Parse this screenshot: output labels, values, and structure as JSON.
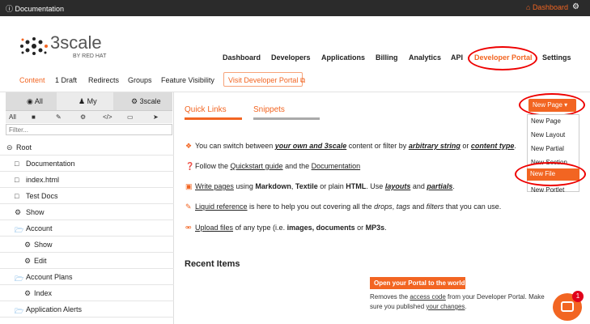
{
  "topbar": {
    "title": "Documentation",
    "dashboard": "Dashboard",
    "info_icon": "info-icon",
    "gear_icon": "gear-icon",
    "home_icon": "home-icon"
  },
  "logo": {
    "name": "3scale",
    "sub": "BY RED HAT"
  },
  "nav": {
    "items": [
      "Dashboard",
      "Developers",
      "Applications",
      "Billing",
      "Analytics",
      "API",
      "Developer Portal",
      "Settings"
    ]
  },
  "subnav": {
    "items": [
      "Content",
      "1 Draft",
      "Redirects",
      "Groups",
      "Feature Visibility"
    ],
    "visit": "Visit Developer Portal"
  },
  "sidebar": {
    "tabs": [
      "All",
      "My",
      "3scale"
    ],
    "types": [
      "All",
      "■",
      "✎",
      "⚙",
      "</>",
      "▭",
      "➤"
    ],
    "filter_placeholder": "Filter...",
    "root": "Root",
    "rows": [
      {
        "label": "Documentation",
        "icon": "file-icon"
      },
      {
        "label": "index.html",
        "icon": "file-icon"
      },
      {
        "label": "Test Docs",
        "icon": "file-icon"
      },
      {
        "label": "Show",
        "icon": "gear-icon"
      },
      {
        "label": "Account",
        "icon": "folder-icon"
      },
      {
        "label": "Show",
        "icon": "gear-icon"
      },
      {
        "label": "Edit",
        "icon": "gear-icon"
      },
      {
        "label": "Account Plans",
        "icon": "folder-icon"
      },
      {
        "label": "Index",
        "icon": "gear-icon"
      },
      {
        "label": "Application Alerts",
        "icon": "folder-icon"
      }
    ]
  },
  "main": {
    "tabs": [
      "Quick Links",
      "Snippets"
    ],
    "new_page": "New Page",
    "dropdown": [
      "New Page",
      "New Layout",
      "New Partial",
      "New Section",
      "New File",
      "New Portlet"
    ],
    "info": [
      {
        "a": "You can switch between ",
        "b": "your own and 3scale",
        "c": " content or filter by ",
        "d": "arbitrary string",
        "e": " or ",
        "f": "content type",
        "g": "."
      },
      {
        "a": "Follow the ",
        "b": "Quickstart guide",
        "c": " and the ",
        "d": "Documentation"
      },
      {
        "a": "Write pages",
        "b": " using ",
        "c": "Markdown",
        "d": ", ",
        "e": "Textile",
        "f": " or plain ",
        "g": "HTML",
        "h": ". Use ",
        "i": "layouts",
        "j": " and ",
        "k": "partials",
        "l": "."
      },
      {
        "a": "Liquid reference",
        "b": " is here to help you out covering all the ",
        "c": "drops",
        "d": ", ",
        "e": "tags",
        "f": " and ",
        "g": "filters",
        "h": " that you can use."
      },
      {
        "a": "Upload files",
        "b": " of any type (i.e. ",
        "c": "images, documents",
        "d": " or ",
        "e": "MP3s",
        "f": "."
      }
    ],
    "recent": "Recent Items",
    "open_portal": "Open your Portal to the world",
    "remove1a": "Removes the ",
    "remove1b": "access code",
    "remove1c": " from your Developer Portal. Make",
    "remove2a": "sure you published ",
    "remove2b": "your changes",
    "remove2c": ".",
    "chat_badge": "1"
  }
}
